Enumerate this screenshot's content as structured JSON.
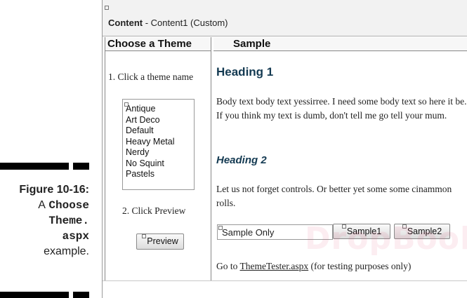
{
  "caption": {
    "figure": "Figure 10-16:",
    "line1_prefix": "A",
    "line1_code": "Choose",
    "line2_code": "Theme.",
    "line3_code": "aspx",
    "line4": "example."
  },
  "designer": {
    "header": {
      "bold_title": "Content",
      "subtitle": " - Content1 (Custom)"
    },
    "left_column": {
      "heading": "Choose a Theme",
      "step1": "1. Click a theme name",
      "themes": [
        "Antique",
        "Art Deco",
        "Default",
        "Heavy Metal",
        "Nerdy",
        "No Squint",
        "Pastels"
      ],
      "step2": "2. Click Preview",
      "preview_button": "Preview"
    },
    "right_column": {
      "heading": "Sample",
      "heading1": "Heading 1",
      "body_text": "Body text body text yessirree. I need some body text so here it be. If you think my text is dumb, don't tell me go tell your mum.",
      "heading2": "Heading 2",
      "controls_text": "Let us not forget controls. Or better yet some some cinammon rolls.",
      "sample_textbox": "Sample Only",
      "sample1_button": "Sample1",
      "sample2_button": "Sample2",
      "goto_prefix": "Go to ",
      "goto_link": "ThemeTester.aspx",
      "goto_suffix": " (for testing purposes only)"
    }
  },
  "watermark": "DropBooks",
  "colors": {
    "heading": "#143a52",
    "header_bg": "#f2f2f2"
  }
}
